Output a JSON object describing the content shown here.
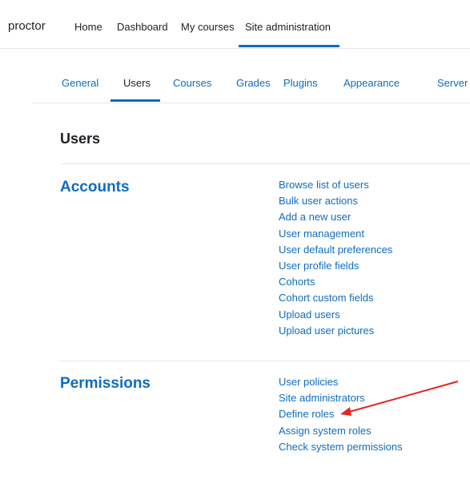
{
  "topnav": {
    "brand": "proctor",
    "items": [
      {
        "label": "Home"
      },
      {
        "label": "Dashboard"
      },
      {
        "label": "My courses"
      },
      {
        "label": "Site administration"
      }
    ],
    "active": "Site administration"
  },
  "subtabs": {
    "items": [
      {
        "label": "General"
      },
      {
        "label": "Users"
      },
      {
        "label": "Courses"
      },
      {
        "label": "Grades"
      },
      {
        "label": "Plugins"
      },
      {
        "label": "Appearance"
      },
      {
        "label": "Server"
      }
    ],
    "active": "Users"
  },
  "page_title": "Users",
  "sections": [
    {
      "heading": "Accounts",
      "links": [
        "Browse list of users",
        "Bulk user actions",
        "Add a new user",
        "User management",
        "User default preferences",
        "User profile fields",
        "Cohorts",
        "Cohort custom fields",
        "Upload users",
        "Upload user pictures"
      ]
    },
    {
      "heading": "Permissions",
      "links": [
        "User policies",
        "Site administrators",
        "Define roles",
        "Assign system roles",
        "Check system permissions"
      ]
    }
  ],
  "annotation": {
    "type": "arrow",
    "color": "#e52421",
    "points_to": "Define roles"
  },
  "colors": {
    "link": "#0f6cbf",
    "text": "#1d2125",
    "divider": "#e3e6ea"
  }
}
